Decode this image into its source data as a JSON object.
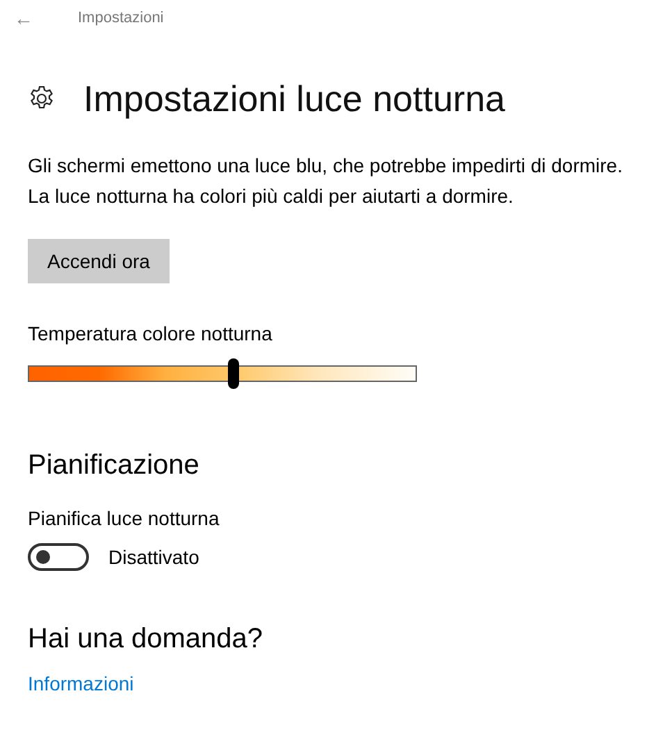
{
  "header": {
    "back": "←",
    "title": "Impostazioni"
  },
  "page_title": "Impostazioni luce notturna",
  "description": "Gli schermi emettono una luce blu, che potrebbe impedirti di dormire. La luce notturna ha colori più caldi per aiutarti a dormire.",
  "button": "Accendi ora",
  "slider": {
    "label": "Temperatura colore notturna",
    "level": 0.53
  },
  "schedule": {
    "heading": "Pianificazione",
    "label": "Pianifica luce notturna",
    "on": false,
    "state_text": "Disattivato"
  },
  "help": {
    "heading": "Hai una domanda?",
    "link": "Informazioni"
  }
}
